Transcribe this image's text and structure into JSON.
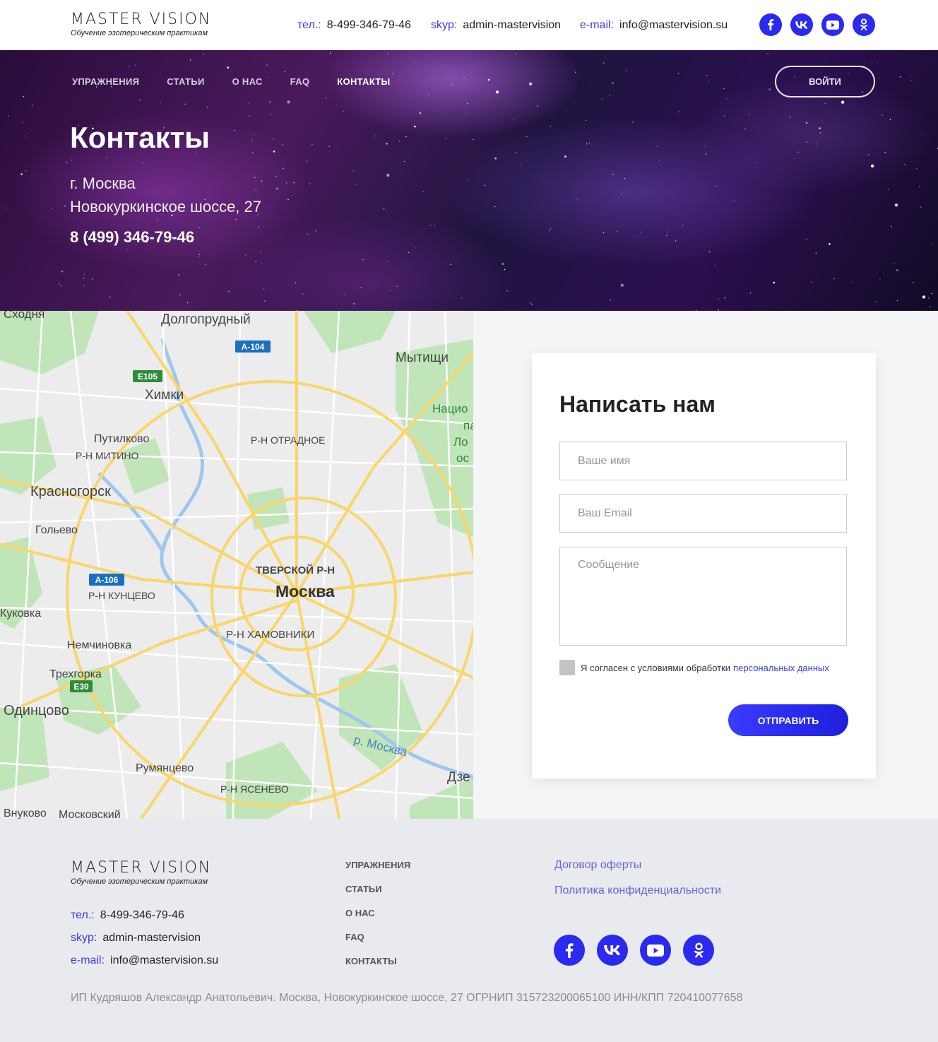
{
  "brand": {
    "title": "MASTER VISION",
    "tagline": "Обучение эзотерическим практикам"
  },
  "header": {
    "phone_label": "тел.:",
    "phone": "8-499-346-79-46",
    "skype_label": "skyp:",
    "skype": "admin-mastervision",
    "email_label": "e-mail:",
    "email": "info@mastervision.su",
    "socials": [
      "facebook-icon",
      "vk-icon",
      "youtube-icon",
      "odnoklassniki-icon"
    ]
  },
  "nav": {
    "items": [
      "УПРАЖНЕНИЯ",
      "СТАТЬИ",
      "О НАС",
      "FAQ",
      "КОНТАКТЫ"
    ],
    "active": "КОНТАКТЫ",
    "login": "ВОЙТИ"
  },
  "hero": {
    "title": "Контакты",
    "city": "г. Москва",
    "street": "Новокуркинское шоссе, 27",
    "phone": "8 (499) 346-79-46"
  },
  "map": {
    "labels": [
      "Сходня",
      "Долгопрудный",
      "Мытищи",
      "Химки",
      "Путилково",
      "Р-Н МИТИНО",
      "Р-Н ОТРАДНОЕ",
      "Красногорск",
      "Гольево",
      "ТВЕРСКОЙ Р-Н",
      "Москва",
      "Р-Н КУНЦЕВО",
      "Куковка",
      "Р-Н ХАМОВНИКИ",
      "Немчиновка",
      "Трехгорка",
      "Одинцово",
      "р. Москва",
      "Румянцево",
      "Р-Н ЯСЕНЕВО",
      "Внуково",
      "Московский",
      "Дзе",
      "Нацио",
      "па",
      "Ло",
      "ос"
    ],
    "road_badges": [
      "A-104",
      "E105",
      "A-106",
      "E30"
    ]
  },
  "form": {
    "title": "Написать нам",
    "name_placeholder": "Ваше имя",
    "email_placeholder": "Ваш Email",
    "message_placeholder": "Сообщение",
    "consent_text": "Я согласен с условиями обработки",
    "consent_link": "персональных данных",
    "submit": "ОТПРАВИТЬ"
  },
  "footer": {
    "nav": [
      "УПРАЖНЕНИЯ",
      "СТАТЬИ",
      "О НАС",
      "FAQ",
      "КОНТАКТЫ"
    ],
    "offer": "Договор оферты",
    "privacy": "Политика конфиденциальности",
    "legal": "ИП Кудряшов Александр Анатольевич. Москва, Новокуркинское шоссе, 27 ОГРНИП 315723200065100 ИНН/КПП 720410077658"
  },
  "colors": {
    "accent": "#2a2af0",
    "link": "#3b3be8",
    "footer_bg": "#e9eaed",
    "form_bg": "#f4f5f7"
  }
}
